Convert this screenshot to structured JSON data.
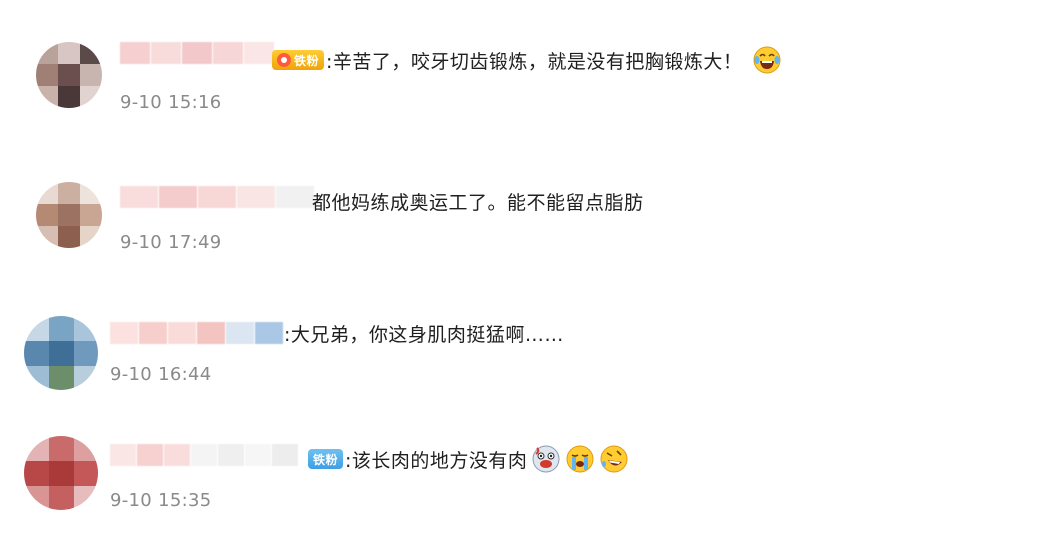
{
  "comments": [
    {
      "badge": "铁粉",
      "badge_style": "gold",
      "text": ":辛苦了，咬牙切齿锻炼，就是没有把胸锻炼大！",
      "time": "9-10 15:16",
      "emojis": [
        "laughing-tears-emoji"
      ]
    },
    {
      "badge": "",
      "text": "都他妈练成奥运工了。能不能留点脂肪",
      "time": "9-10 17:49",
      "emojis": []
    },
    {
      "badge": "",
      "text": ":大兄弟，你这身肌肉挺猛啊……",
      "time": "9-10 16:44",
      "emojis": []
    },
    {
      "badge": "铁粉",
      "badge_style": "blue",
      "text": ":该长肉的地方没有肉",
      "time": "9-10 15:35",
      "emojis": [
        "drooling-emoji",
        "crying-emoji",
        "rolling-laugh-emoji"
      ]
    }
  ],
  "colors": {
    "text": "#1f1f1f",
    "timestamp": "#8a8a8a",
    "badge_gold": "#f0a30a",
    "badge_blue": "#3d9ee6"
  }
}
